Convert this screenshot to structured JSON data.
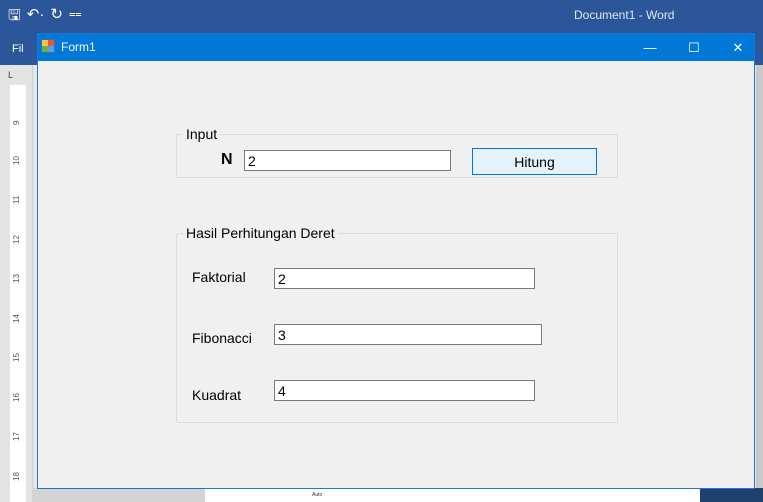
{
  "word": {
    "title": "Document1 - Word",
    "file_tab": "Fil",
    "ruler_numbers": [
      "9",
      "10",
      "11",
      "12",
      "13",
      "14",
      "15",
      "16",
      "17",
      "18"
    ],
    "bottom_text": "Auto"
  },
  "form": {
    "title": "Form1",
    "window_buttons": {
      "minimize": "—",
      "maximize": "☐",
      "close": "✕"
    },
    "input_group": {
      "legend": "Input",
      "n_label": "N",
      "n_value": "2",
      "button_label": "Hitung"
    },
    "result_group": {
      "legend": "Hasil Perhitungan Deret",
      "faktorial_label": "Faktorial",
      "faktorial_value": "2",
      "fibonacci_label": "Fibonacci",
      "fibonacci_value": "3",
      "kuadrat_label": "Kuadrat",
      "kuadrat_value": "4"
    }
  },
  "colors": {
    "word_blue": "#2b579a",
    "form_titlebar": "#0078d7",
    "form_bg": "#f0f0f0",
    "button_bg": "#e5f1fb"
  }
}
